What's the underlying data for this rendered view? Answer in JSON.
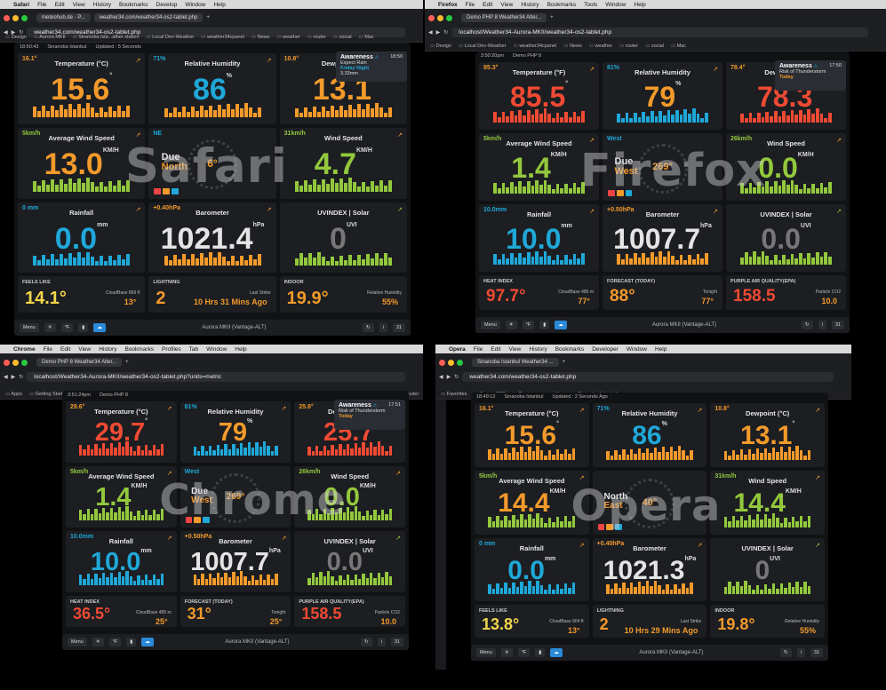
{
  "colors": {
    "orange": "#f39a2b",
    "blue": "#1fa8d8",
    "green": "#93c83d",
    "red": "#ef4a33",
    "yellow": "#f2d64b",
    "panel": "#1c1e22"
  },
  "panes": [
    {
      "key": "safari",
      "watermark": "Safari",
      "menubar": [
        "Safari",
        "File",
        "Edit",
        "View",
        "History",
        "Bookmarks",
        "Develop",
        "Window",
        "Help"
      ],
      "tabs": [
        "meteohub.de - P...",
        "weather34.com/weather34-os2-tablet.php"
      ],
      "url": "weather34.com/weather34-os2-tablet.php",
      "bookmarks": [
        "Design",
        "Aurora MKII",
        "Sinanoba ista...ather station",
        "Local Dev-Weather",
        "weather34cpanel",
        "News",
        "weather",
        "router",
        "social",
        "Mac"
      ],
      "topbar": {
        "time": "18:50:43",
        "location": "Sinanoba Istanbul",
        "updated": "Updated : 5 Seconds"
      },
      "awareness": {
        "title": "Awareness",
        "time": "18:50",
        "line1": "Expect Rain",
        "line2": "Friday Night",
        "line3": "3.33mm"
      },
      "tiles": {
        "temp": {
          "mini": "16.1°",
          "title": "Temperature (°C)",
          "value": "15.6",
          "unit": "°"
        },
        "hum": {
          "mini": "71%",
          "title": "Relative Humidity",
          "value": "86",
          "unit": "%"
        },
        "dew": {
          "mini": "10.8°",
          "title": "Dewpoint (°C)",
          "value": "13.1",
          "unit": "°"
        },
        "wind": {
          "mini": "5km/h",
          "title": "Average Wind Speed",
          "value": "13.0",
          "unit": "KM/H"
        },
        "dir": {
          "mini": "NE",
          "line1": "Due",
          "line2": "North",
          "deg": "6°"
        },
        "gust": {
          "mini": "31km/h",
          "title": "Wind Speed",
          "value": "4.7",
          "unit": "KM/H"
        },
        "rain": {
          "mini": "0 mm",
          "title": "Rainfall",
          "value": "0.0",
          "unit": "mm"
        },
        "baro": {
          "mini": "+0.40hPa",
          "title": "Barometer",
          "value": "1021.4",
          "unit": "hPa"
        },
        "uv": {
          "title": "UVINDEX | Solar",
          "value": "0",
          "unit": "UVI"
        },
        "feels": {
          "label": "FEELS LIKE",
          "value": "14.1°",
          "sub": "CloudBase 869 ft",
          "sub2": "13°"
        },
        "light": {
          "label": "LIGHTNING",
          "value": "2",
          "sub": "Last Strike",
          "sub2": "10 Hrs 31 Mins Ago"
        },
        "indoor": {
          "label": "INDOOR",
          "value": "19.9°",
          "sub": "Relative Humidity",
          "sub2": "55%"
        }
      },
      "footer": {
        "menu": "Menu",
        "center": "Aurora MKII (Vantage-ALT)"
      }
    },
    {
      "key": "firefox",
      "watermark": "Firefox",
      "menubar": [
        "Firefox",
        "File",
        "Edit",
        "View",
        "History",
        "Bookmarks",
        "Tools",
        "Window",
        "Help"
      ],
      "tabs": [
        "Demo PHP 8 Weather34 Alter..."
      ],
      "url": "localhost/Weather34-Aurora-MKII/weather34-os2-tablet.php",
      "bookmarks": [
        "Design",
        "Local Dev-Weather",
        "weather34cpanel",
        "News",
        "weather",
        "router",
        "social",
        "Mac"
      ],
      "topbar": {
        "time": "3:50:20pm",
        "location": "Demo PHP 8",
        "updated": ""
      },
      "awareness": {
        "title": "Awareness",
        "time": "17:50",
        "line1": "Risk of Thunderstorm",
        "line2": "Today",
        "line3": ""
      },
      "tiles": {
        "temp": {
          "mini": "85.3°",
          "title": "Temperature (°F)",
          "value": "85.5",
          "unit": "°"
        },
        "hum": {
          "mini": "81%",
          "title": "Relative Humidity",
          "value": "79",
          "unit": "%"
        },
        "dew": {
          "mini": "78.4°",
          "title": "Dewpoint (°F)",
          "value": "78.3",
          "unit": "°"
        },
        "wind": {
          "mini": "5km/h",
          "title": "Average Wind Speed",
          "value": "1.4",
          "unit": "KM/H"
        },
        "dir": {
          "mini": "West",
          "line1": "Due",
          "line2": "West",
          "deg": "269°"
        },
        "gust": {
          "mini": "26km/h",
          "title": "Wind Speed",
          "value": "0.0",
          "unit": "KM/H"
        },
        "rain": {
          "mini": "10.0mm",
          "title": "Rainfall",
          "value": "10.0",
          "unit": "mm"
        },
        "baro": {
          "mini": "+0.50hPa",
          "title": "Barometer",
          "value": "1007.7",
          "unit": "hPa"
        },
        "uv": {
          "title": "UVINDEX | Solar",
          "value": "0.0",
          "unit": "UVI"
        },
        "feels": {
          "label": "HEAT INDEX",
          "value": "97.7°",
          "sub": "CloudBase 485 m",
          "sub2": "77°"
        },
        "light": {
          "label": "FORECAST (TODAY)",
          "value": "88°",
          "sub": "Tonight",
          "sub2": "77°"
        },
        "indoor": {
          "label": "PURPLE AIR QUALITY(EPA)",
          "value": "158.5",
          "sub": "Particle CO2",
          "sub2": "10.0"
        }
      },
      "footer": {
        "menu": "Menu",
        "center": "Aurora MKII (Vantage-ALT)"
      }
    },
    {
      "key": "chrome",
      "watermark": "Chrome",
      "menubar": [
        "Chrome",
        "File",
        "Edit",
        "View",
        "History",
        "Bookmarks",
        "Profiles",
        "Tab",
        "Window",
        "Help"
      ],
      "tabs": [
        "Demo PHP 8 Weather34 Alter..."
      ],
      "url": "localhost/Weather34-Aurora-MKII/weather34-os2-tablet.php?units=metric",
      "bookmarks": [
        "Apps",
        "Getting Started",
        "Design",
        "Aurora Sites",
        "Sinanoba Istanbul",
        "Smartweather",
        "Local Dev-Weather",
        "weather34cpanel",
        "News",
        "weather",
        "router"
      ],
      "topbar": {
        "time": "3:51:24pm",
        "location": "Demo PHP 8",
        "updated": ""
      },
      "awareness": {
        "title": "Awareness",
        "time": "17:51",
        "line1": "Risk of Thunderstorm",
        "line2": "Today",
        "line3": ""
      },
      "tiles": {
        "temp": {
          "mini": "29.6°",
          "title": "Temperature (°C)",
          "value": "29.7",
          "unit": "°"
        },
        "hum": {
          "mini": "81%",
          "title": "Relative Humidity",
          "value": "79",
          "unit": "%"
        },
        "dew": {
          "mini": "25.8°",
          "title": "Dewpoint (°C)",
          "value": "25.7",
          "unit": "°"
        },
        "wind": {
          "mini": "5km/h",
          "title": "Average Wind Speed",
          "value": "1.4",
          "unit": "KM/H"
        },
        "dir": {
          "mini": "West",
          "line1": "Due",
          "line2": "West",
          "deg": "269°"
        },
        "gust": {
          "mini": "26km/h",
          "title": "Wind Speed",
          "value": "0.0",
          "unit": "KM/H"
        },
        "rain": {
          "mini": "10.0mm",
          "title": "Rainfall",
          "value": "10.0",
          "unit": "mm"
        },
        "baro": {
          "mini": "+0.50hPa",
          "title": "Barometer",
          "value": "1007.7",
          "unit": "hPa"
        },
        "uv": {
          "title": "UVINDEX | Solar",
          "value": "0.0",
          "unit": "UVI"
        },
        "feels": {
          "label": "HEAT INDEX",
          "value": "36.5°",
          "sub": "CloudBase 485 m",
          "sub2": "25°"
        },
        "light": {
          "label": "FORECAST (TODAY)",
          "value": "31°",
          "sub": "Tonight",
          "sub2": "25°"
        },
        "indoor": {
          "label": "PURPLE AIR QUALITY(EPA)",
          "value": "158.5",
          "sub": "Particle CO2",
          "sub2": "10.0"
        }
      },
      "footer": {
        "menu": "Menu",
        "center": "Aurora MKII (Vantage-ALT)"
      }
    },
    {
      "key": "opera",
      "watermark": "Opera",
      "menubar": [
        "Opera",
        "File",
        "Edit",
        "View",
        "History",
        "Bookmarks",
        "Developer",
        "Window",
        "Help"
      ],
      "tabs": [
        "Sinanoba Istanbul Weather34 ..."
      ],
      "url": "weather34.com/weather34-os2-tablet.php",
      "bookmarks": [
        "Favorites",
        "Aurora MKII",
        "Design",
        "weather",
        "Sinanoba Istanbul w..."
      ],
      "topbar": {
        "time": "18:49:12",
        "location": "Sinanoba Istanbul",
        "updated": "Updated : 2 Seconds Ago"
      },
      "awareness": null,
      "tiles": {
        "temp": {
          "mini": "16.1°",
          "title": "Temperature (°C)",
          "value": "15.6",
          "unit": "°"
        },
        "hum": {
          "mini": "71%",
          "title": "Relative Humidity",
          "value": "86",
          "unit": "%"
        },
        "dew": {
          "mini": "10.8°",
          "title": "Dewpoint (°C)",
          "value": "13.1",
          "unit": "°"
        },
        "wind": {
          "mini": "5km/h",
          "title": "Average Wind Speed",
          "value": "14.4",
          "unit": "KM/H"
        },
        "dir": {
          "mini": "",
          "line1": "North",
          "line2": "East",
          "deg": "40°"
        },
        "gust": {
          "mini": "31km/h",
          "title": "Wind Speed",
          "value": "14.4",
          "unit": "KM/H"
        },
        "rain": {
          "mini": "0 mm",
          "title": "Rainfall",
          "value": "0.0",
          "unit": "mm"
        },
        "baro": {
          "mini": "+0.40hPa",
          "title": "Barometer",
          "value": "1021.3",
          "unit": "hPa"
        },
        "uv": {
          "title": "UVINDEX | Solar",
          "value": "0",
          "unit": "UVI"
        },
        "feels": {
          "label": "FEELS LIKE",
          "value": "13.8°",
          "sub": "CloudBase 904 ft",
          "sub2": "13°"
        },
        "light": {
          "label": "LIGHTNING",
          "value": "2",
          "sub": "Last Strike",
          "sub2": "10 Hrs 29 Mins Ago"
        },
        "indoor": {
          "label": "INDOOR",
          "value": "19.8°",
          "sub": "Relative Humidity",
          "sub2": "55%"
        }
      },
      "footer": {
        "menu": "Menu",
        "center": "Aurora MKII (Vantage-ALT)"
      }
    }
  ]
}
